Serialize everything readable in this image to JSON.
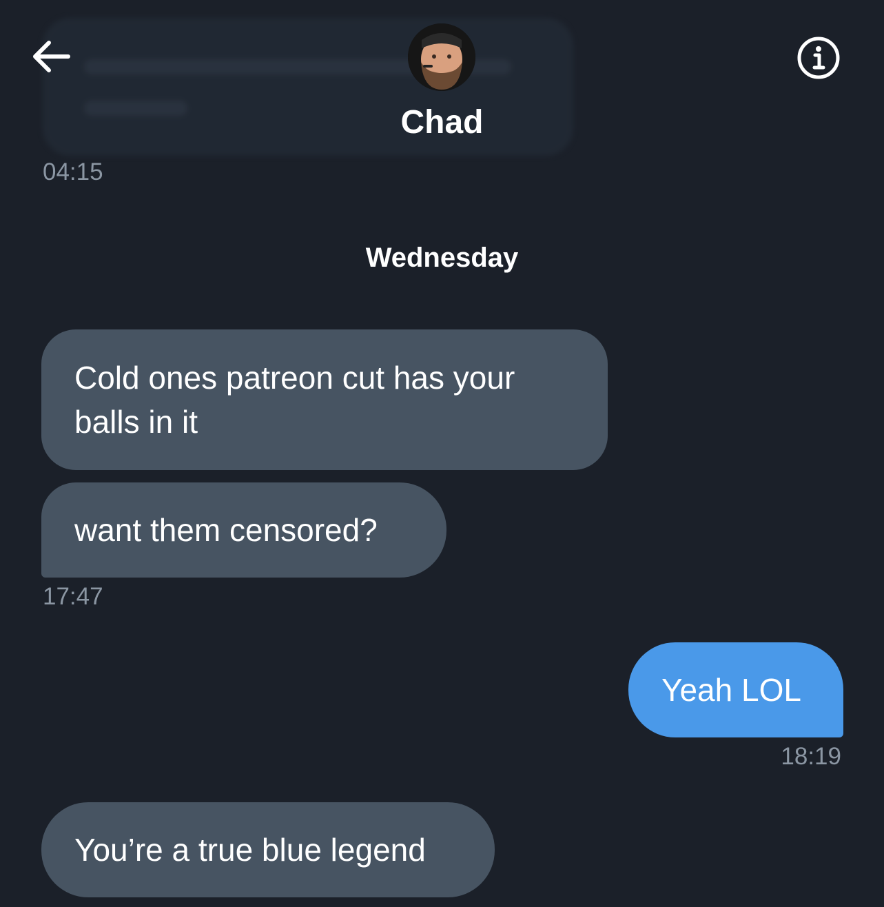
{
  "header": {
    "back_icon": "arrow-left-icon",
    "info_icon": "info-circle-icon",
    "contact_name": "Chad",
    "avatar_icon": "profile-avatar"
  },
  "colors": {
    "background": "#1b2029",
    "received_bubble": "#475462",
    "sent_bubble": "#4a99e9",
    "timestamp": "#8b96a3"
  },
  "conversation": {
    "previous_time": "04:15",
    "day_separator": "Wednesday",
    "messages": [
      {
        "from": "contact",
        "text": "Cold ones patreon cut has your balls in it"
      },
      {
        "from": "contact",
        "text": "want them censored?",
        "time": "17:47"
      },
      {
        "from": "me",
        "text": "Yeah LOL",
        "time": "18:19"
      },
      {
        "from": "contact",
        "text": "You’re a true blue legend"
      }
    ]
  }
}
